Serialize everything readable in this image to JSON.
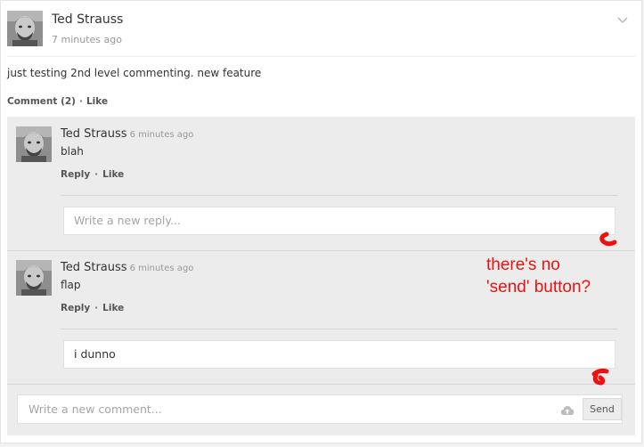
{
  "post": {
    "author": "Ted Strauss",
    "time": "7 minutes ago",
    "text": "just testing 2nd level commenting. new feature",
    "comment_label": "Comment (2)",
    "separator": "·",
    "like_label": "Like"
  },
  "comments": [
    {
      "author": "Ted Strauss",
      "time": "6 minutes ago",
      "text": "blah",
      "reply_label": "Reply",
      "like_label": "Like",
      "reply_input": {
        "placeholder": "Write a new reply...",
        "value": ""
      }
    },
    {
      "author": "Ted Strauss",
      "time": "6 minutes ago",
      "text": "flap",
      "reply_label": "Reply",
      "like_label": "Like",
      "reply_input": {
        "placeholder": "",
        "value": "i dunno"
      }
    }
  ],
  "new_comment": {
    "placeholder": "Write a new comment...",
    "send_label": "Send"
  },
  "annotation": {
    "line1": "there's no",
    "line2": "'send' button?",
    "color": "#ee1111"
  },
  "icons": {
    "menu": "chevron-down-icon",
    "upload": "cloud-upload-icon"
  }
}
